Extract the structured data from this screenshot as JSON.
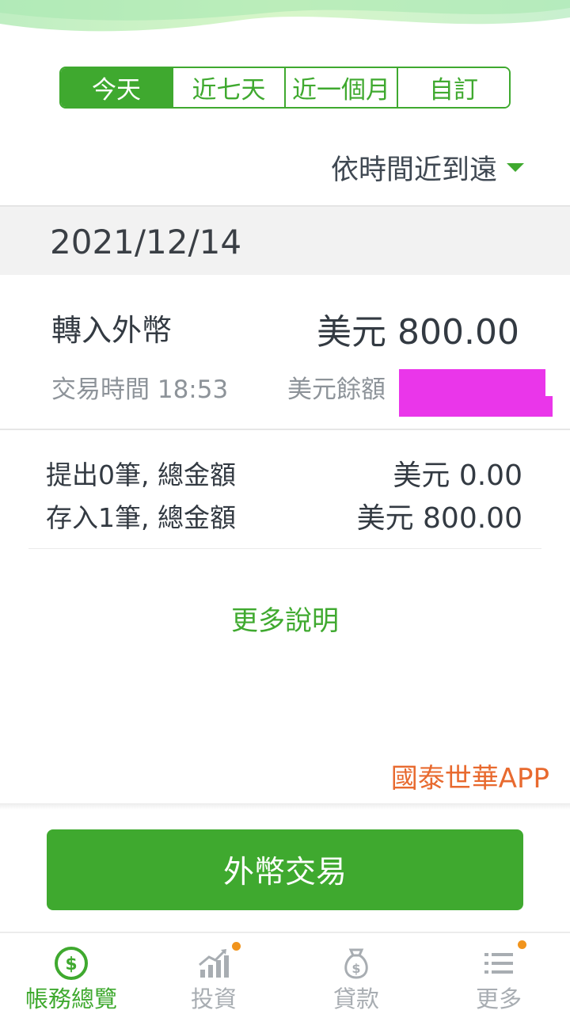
{
  "filters": {
    "tabs": [
      {
        "label": "今天",
        "active": true
      },
      {
        "label": "近七天",
        "active": false
      },
      {
        "label": "近一個月",
        "active": false
      },
      {
        "label": "自訂",
        "active": false
      }
    ]
  },
  "sort": {
    "label": "依時間近到遠",
    "icon": "caret-down-icon"
  },
  "date_header": "2021/12/14",
  "transaction": {
    "title": "轉入外幣",
    "amount": "美元 800.00",
    "time": "交易時間 18:53",
    "balance_label": "美元餘額"
  },
  "summary": [
    {
      "label": "提出0筆, 總金額",
      "value": "美元 0.00"
    },
    {
      "label": "存入1筆, 總金額",
      "value": "美元 800.00"
    }
  ],
  "more_info": "更多說明",
  "brand": "國泰世華APP",
  "action_button": "外幣交易",
  "tabbar": [
    {
      "label": "帳務總覽",
      "icon": "dollar-coin-icon",
      "active": true,
      "badge": false
    },
    {
      "label": "投資",
      "icon": "chart-up-icon",
      "active": false,
      "badge": true
    },
    {
      "label": "貸款",
      "icon": "money-bag-icon",
      "active": false,
      "badge": false
    },
    {
      "label": "更多",
      "icon": "menu-list-icon",
      "active": false,
      "badge": true
    }
  ],
  "colors": {
    "accent": "#3fa92f",
    "brand": "#e86a2f",
    "badge": "#f1941d",
    "redaction": "#ea36ea"
  }
}
